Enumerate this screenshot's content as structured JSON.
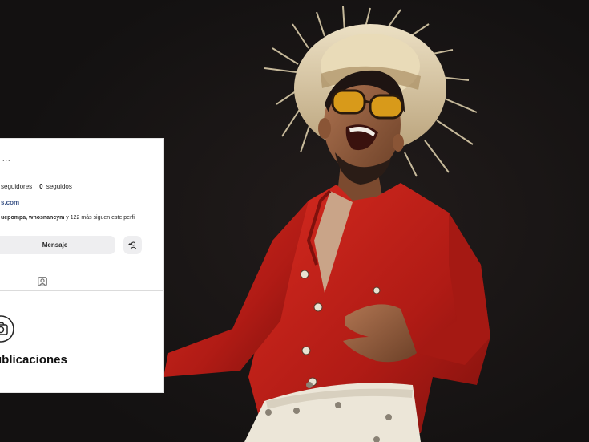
{
  "profile": {
    "more_glyph": "...",
    "followers_count": "",
    "followers_label": "seguidores",
    "following_count": "0",
    "following_label": "seguidos",
    "website": "s.com",
    "followed_by_users": "uepompa, whosnancym",
    "followed_by_rest": " y 122 más siguen este perfil",
    "message_button": "Mensaje",
    "empty_state_title": "ublicaciones"
  },
  "icons": {
    "add_user": "add-user-icon",
    "tagged": "tagged-photos-icon",
    "camera": "camera-icon"
  },
  "colors": {
    "background": "#171414",
    "shirt": "#c0201a",
    "link": "#385185",
    "button": "#eeeef0"
  }
}
